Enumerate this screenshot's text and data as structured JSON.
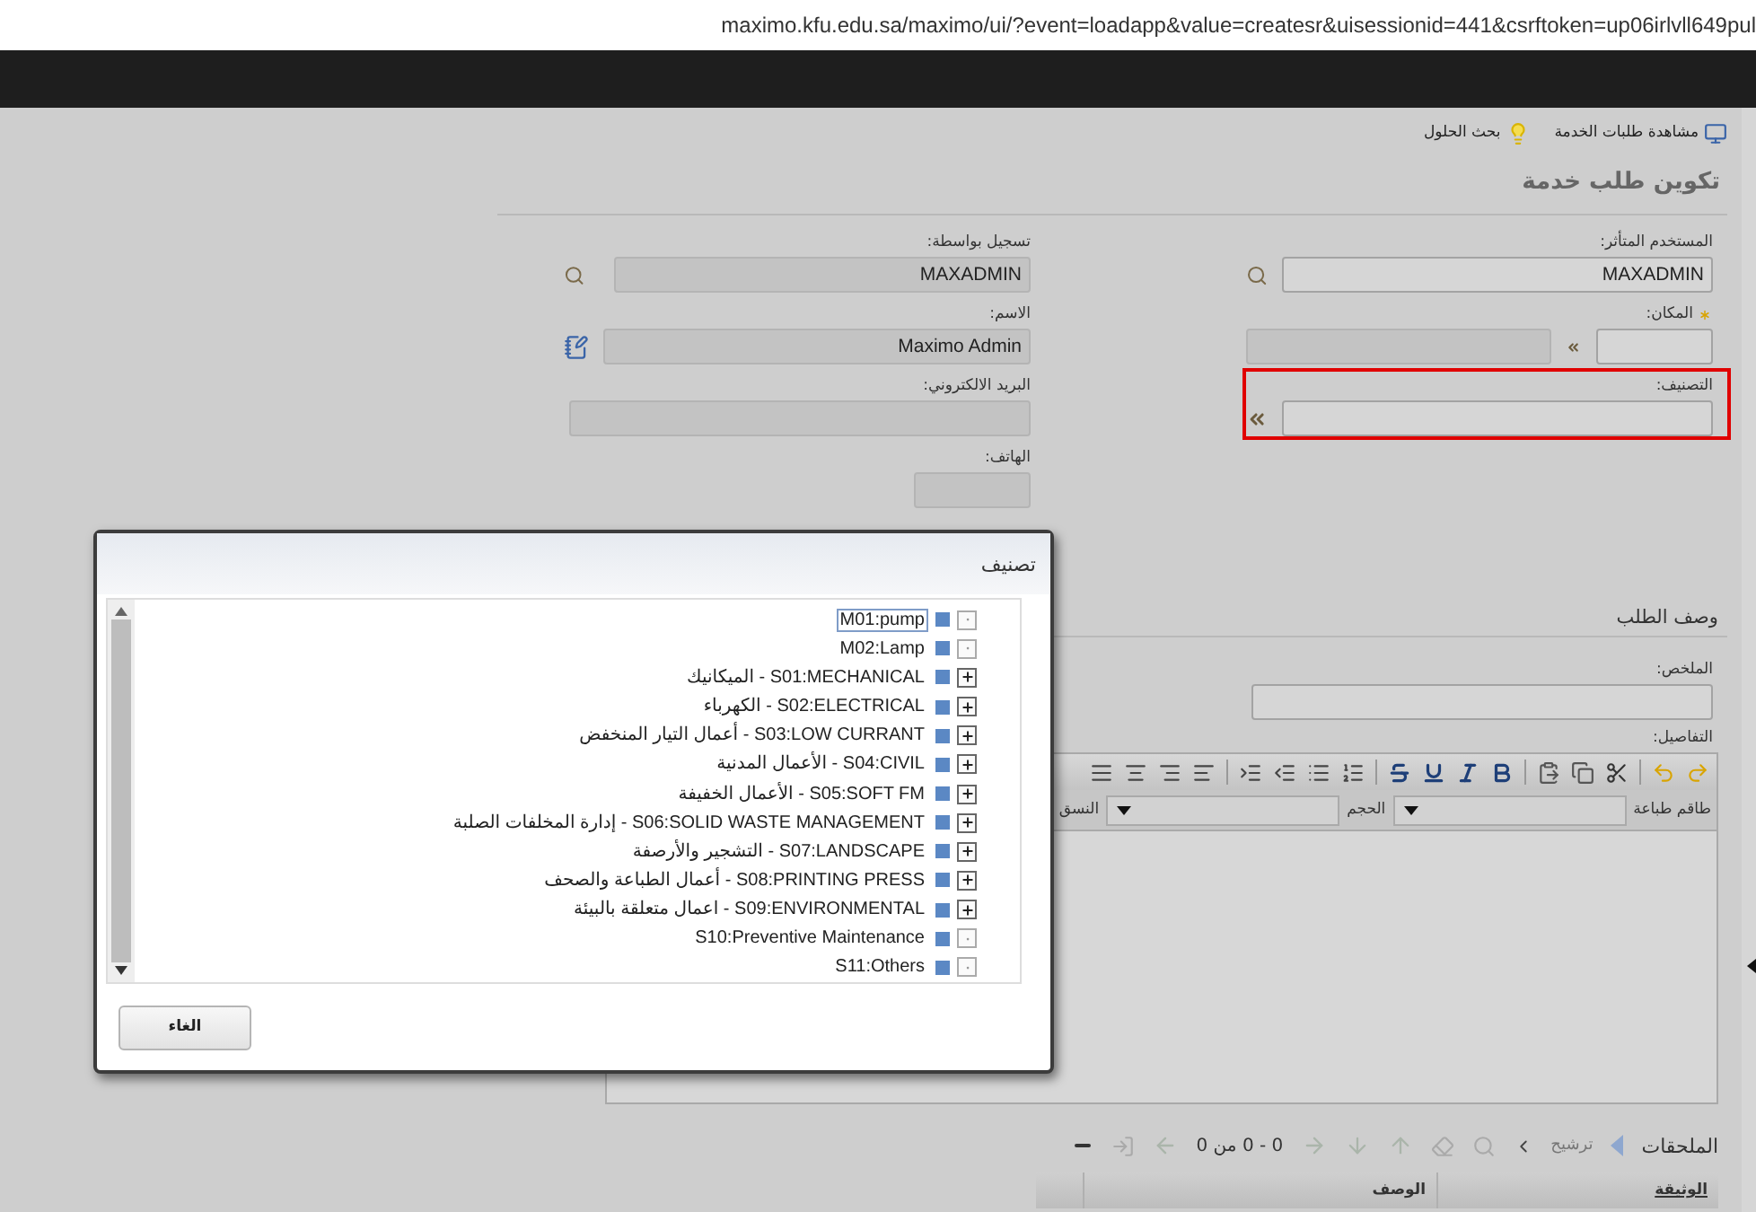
{
  "address_bar": {
    "url": "maximo.kfu.edu.sa/maximo/ui/?event=loadapp&value=createsr&uisessionid=441&csrftoken=up06irlvll649pul"
  },
  "toolbar": [
    {
      "label": "مشاهدة طلبات الخدمة",
      "kind": "view"
    },
    {
      "label": "بحث الحلول",
      "kind": "bulb"
    }
  ],
  "page_title": "تكوين طلب خدمة",
  "form": {
    "right": [
      {
        "label": "المستخدم المتأثر:",
        "value": "MAXADMIN",
        "kind": "lookup"
      },
      {
        "label": "المكان:",
        "kind": "location",
        "required": true
      },
      {
        "label": "التصنيف:",
        "kind": "classification",
        "highlighted": true
      }
    ],
    "left": [
      {
        "label": "تسجيل بواسطة:",
        "value": "MAXADMIN",
        "kind": "lookup"
      },
      {
        "label": "الاسم:",
        "value": "Maximo Admin",
        "kind": "person"
      },
      {
        "label": "البريد الالكتروني:",
        "kind": "text"
      },
      {
        "label": "الهاتف:",
        "kind": "short"
      }
    ]
  },
  "description": {
    "title": "وصف الطلب",
    "summary_label": "الملخص:",
    "details_label": "التفاصيل:",
    "font_labels": [
      "طاقم طباعة",
      "الحجم",
      "النسق"
    ]
  },
  "attachments": {
    "title": "الملحقات",
    "filter": "ترشيح",
    "count": "0 - 0 من 0",
    "columns": [
      "الوثيقة",
      "الوصف"
    ]
  },
  "dialog": {
    "title": "تصنيف",
    "cancel": "الغاء",
    "items": [
      {
        "label": "M01:pump",
        "expandable": false,
        "selected": true
      },
      {
        "label": "M02:Lamp",
        "expandable": false,
        "selected": false
      },
      {
        "label": "S01:MECHANICAL - الميكانيك",
        "expandable": true,
        "selected": false
      },
      {
        "label": "S02:ELECTRICAL - الكهرباء",
        "expandable": true,
        "selected": false
      },
      {
        "label": "S03:LOW CURRANT - أعمال التيار المنخفض",
        "expandable": true,
        "selected": false
      },
      {
        "label": "S04:CIVIL - الأعمال المدنية",
        "expandable": true,
        "selected": false
      },
      {
        "label": "S05:SOFT FM - الأعمال الخفيفة",
        "expandable": true,
        "selected": false
      },
      {
        "label": "S06:SOLID WASTE MANAGEMENT - إدارة المخلفات الصلبة",
        "expandable": true,
        "selected": false
      },
      {
        "label": "S07:LANDSCAPE - التشجير والأرصفة",
        "expandable": true,
        "selected": false
      },
      {
        "label": "S08:PRINTING PRESS - أعمال الطباعة والصحف",
        "expandable": true,
        "selected": false
      },
      {
        "label": "S09:ENVIRONMENTAL - اعمال متعلقة بالبيئة",
        "expandable": true,
        "selected": false
      },
      {
        "label": "S10:Preventive Maintenance",
        "expandable": false,
        "selected": false
      },
      {
        "label": "S11:Others",
        "expandable": false,
        "selected": false
      }
    ]
  }
}
